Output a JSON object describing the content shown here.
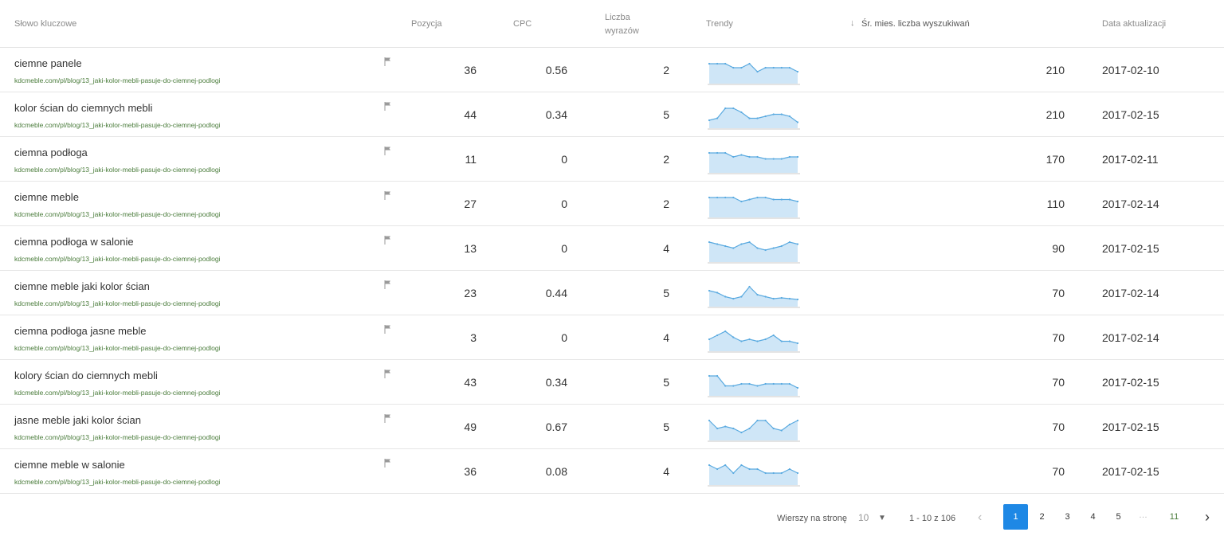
{
  "colors": {
    "accent": "#1e88e5",
    "spark_line": "#5aaae0",
    "spark_fill": "#cfe6f7",
    "url_green": "#4a7c3b"
  },
  "header": {
    "keyword": "Słowo kluczowe",
    "position": "Pozycja",
    "cpc": "CPC",
    "words_line1": "Liczba",
    "words_line2": "wyrazów",
    "trends": "Trendy",
    "volume": "Śr. mies. liczba wyszukiwań",
    "sort_icon": "arrow-down-icon",
    "date": "Data aktualizacji"
  },
  "rows": [
    {
      "keyword": "ciemne panele",
      "url": "kdcmeble.com/pl/blog/13_jaki-kolor-mebli-pasuje-do-ciemnej-podlogi",
      "position": "36",
      "cpc": "0.56",
      "words": "2",
      "volume": "210",
      "date": "2017-02-10",
      "trend": [
        5,
        5,
        5,
        4,
        4,
        5,
        3,
        4,
        4,
        4,
        4,
        3
      ]
    },
    {
      "keyword": "kolor ścian do ciemnych mebli",
      "url": "kdcmeble.com/pl/blog/13_jaki-kolor-mebli-pasuje-do-ciemnej-podlogi",
      "position": "44",
      "cpc": "0.34",
      "words": "5",
      "volume": "210",
      "date": "2017-02-15",
      "trend": [
        2,
        2.5,
        5,
        5,
        4,
        2.5,
        2.5,
        3,
        3.5,
        3.5,
        3,
        1.5
      ]
    },
    {
      "keyword": "ciemna podłoga",
      "url": "kdcmeble.com/pl/blog/13_jaki-kolor-mebli-pasuje-do-ciemnej-podlogi",
      "position": "11",
      "cpc": "0",
      "words": "2",
      "volume": "170",
      "date": "2017-02-11",
      "trend": [
        5,
        5,
        5,
        4,
        4.5,
        4,
        4,
        3.5,
        3.5,
        3.5,
        4,
        4
      ]
    },
    {
      "keyword": "ciemne meble",
      "url": "kdcmeble.com/pl/blog/13_jaki-kolor-mebli-pasuje-do-ciemnej-podlogi",
      "position": "27",
      "cpc": "0",
      "words": "2",
      "volume": "110",
      "date": "2017-02-14",
      "trend": [
        5,
        5,
        5,
        5,
        4,
        4.5,
        5,
        5,
        4.5,
        4.5,
        4.5,
        4
      ]
    },
    {
      "keyword": "ciemna podłoga w salonie",
      "url": "kdcmeble.com/pl/blog/13_jaki-kolor-mebli-pasuje-do-ciemnej-podlogi",
      "position": "13",
      "cpc": "0",
      "words": "4",
      "volume": "90",
      "date": "2017-02-15",
      "trend": [
        5,
        4.5,
        4,
        3.5,
        4.5,
        5,
        3.5,
        3,
        3.5,
        4,
        5,
        4.5
      ]
    },
    {
      "keyword": "ciemne meble jaki kolor ścian",
      "url": "kdcmeble.com/pl/blog/13_jaki-kolor-mebli-pasuje-do-ciemnej-podlogi",
      "position": "23",
      "cpc": "0.44",
      "words": "5",
      "volume": "70",
      "date": "2017-02-14",
      "trend": [
        4,
        3.5,
        2.5,
        2,
        2.5,
        5,
        3,
        2.5,
        2,
        2.2,
        2,
        1.8
      ]
    },
    {
      "keyword": "ciemna podłoga jasne meble",
      "url": "kdcmeble.com/pl/blog/13_jaki-kolor-mebli-pasuje-do-ciemnej-podlogi",
      "position": "3",
      "cpc": "0",
      "words": "4",
      "volume": "70",
      "date": "2017-02-14",
      "trend": [
        3,
        4,
        5,
        3.5,
        2.5,
        3,
        2.5,
        3,
        4,
        2.5,
        2.5,
        2
      ]
    },
    {
      "keyword": "kolory ścian do ciemnych mebli",
      "url": "kdcmeble.com/pl/blog/13_jaki-kolor-mebli-pasuje-do-ciemnej-podlogi",
      "position": "43",
      "cpc": "0.34",
      "words": "5",
      "volume": "70",
      "date": "2017-02-15",
      "trend": [
        5,
        5,
        2.5,
        2.5,
        3,
        3,
        2.5,
        3,
        3,
        3,
        3,
        2
      ]
    },
    {
      "keyword": "jasne meble jaki kolor ścian",
      "url": "kdcmeble.com/pl/blog/13_jaki-kolor-mebli-pasuje-do-ciemnej-podlogi",
      "position": "49",
      "cpc": "0.67",
      "words": "5",
      "volume": "70",
      "date": "2017-02-15",
      "trend": [
        5,
        3,
        3.5,
        3,
        2,
        3,
        5,
        5,
        3,
        2.5,
        4,
        5
      ]
    },
    {
      "keyword": "ciemne meble w salonie",
      "url": "kdcmeble.com/pl/blog/13_jaki-kolor-mebli-pasuje-do-ciemnej-podlogi",
      "position": "36",
      "cpc": "0.08",
      "words": "4",
      "volume": "70",
      "date": "2017-02-15",
      "trend": [
        5,
        4,
        5,
        3,
        5,
        4,
        4,
        3,
        3,
        3,
        4,
        3
      ]
    }
  ],
  "pagination": {
    "rows_label": "Wierszy na stronę",
    "rows_value": "10",
    "range": "1 - 10 z 106",
    "pages": [
      "1",
      "2",
      "3",
      "4",
      "5"
    ],
    "dots": "…",
    "last": "11",
    "active": "1",
    "prev_icon": "chevron-left-icon",
    "next_icon": "chevron-right-icon"
  }
}
